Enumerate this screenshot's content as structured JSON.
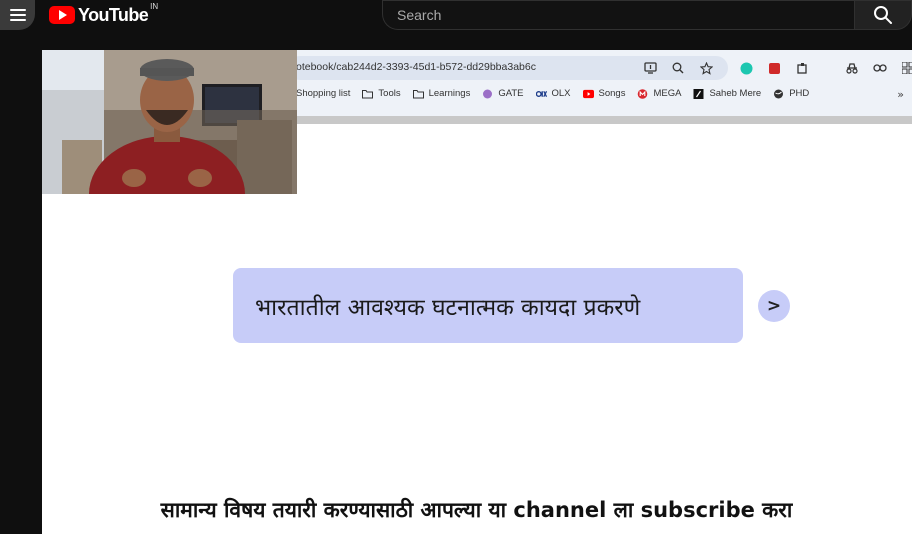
{
  "app": {
    "logo_text": "YouTube",
    "country_code": "IN"
  },
  "search": {
    "placeholder": "Search"
  },
  "video": {
    "browser": {
      "url": "otebook/cab244d2-3393-45d1-b572-dd29bba3ab6c",
      "bookmarks": [
        {
          "label": "Shopping list"
        },
        {
          "label": "Tools"
        },
        {
          "label": "Learnings"
        },
        {
          "label": "GATE"
        },
        {
          "label": "OLX"
        },
        {
          "label": "Songs"
        },
        {
          "label": "MEGA"
        },
        {
          "label": "Saheb Mere"
        },
        {
          "label": "PHD"
        }
      ],
      "more_label": "»"
    },
    "highlight_text": "भारतातील आवश्यक घटनात्मक कायदा प्रकरणे",
    "next_label": ">",
    "caption": "सामान्य विषय तयारी करण्यासाठी आपल्या या channel ला subscribe करा"
  },
  "colors": {
    "youtube_red": "#ff0000",
    "highlight_box": "#c7ccf8",
    "background": "#0f0f0f"
  }
}
